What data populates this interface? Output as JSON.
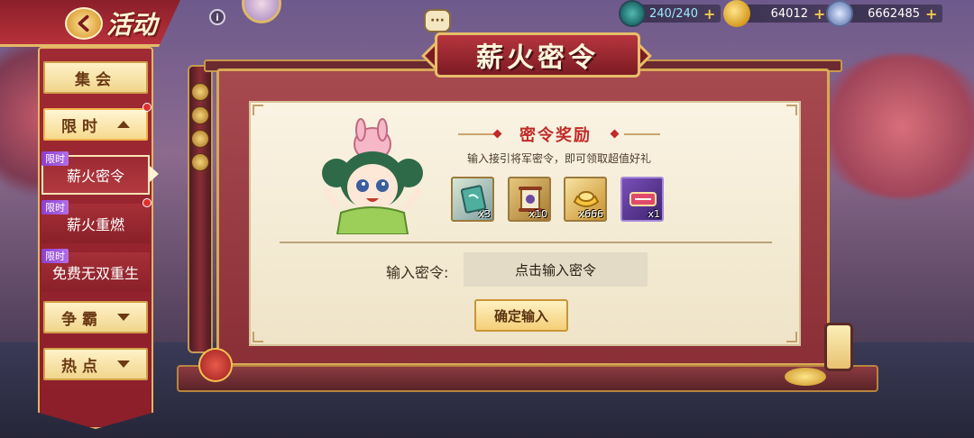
{
  "header": {
    "title": "活动",
    "info_icon_text": "i",
    "chat_icon_text": "···"
  },
  "resources": {
    "stamina": "240/240",
    "gold": "64012",
    "coin": "6662485",
    "plus": "+"
  },
  "sidebar": {
    "menu_gathering": "集会",
    "menu_limited": "限时",
    "menu_contend": "争霸",
    "menu_hot": "热点",
    "limited_tag": "限时",
    "sub_items": [
      {
        "label": "薪火密令"
      },
      {
        "label": "薪火重燃"
      },
      {
        "label": "免费无双重生"
      }
    ]
  },
  "panel": {
    "title": "薪火密令",
    "reward_title": "密令奖励",
    "reward_desc": "输入接引将军密令，即可领取超值好礼",
    "items": [
      {
        "icon": "book-icon",
        "count": "x3"
      },
      {
        "icon": "scroll-icon",
        "count": "x10"
      },
      {
        "icon": "gold-ingot-icon",
        "count": "x666"
      },
      {
        "icon": "battle-card-icon",
        "count": "x1"
      }
    ],
    "code_label": "输入密令:",
    "code_placeholder": "点击输入密令",
    "confirm_label": "确定输入"
  },
  "colors": {
    "accent_red": "#8c1f2a",
    "gold_border": "#e3b565",
    "reward_title_red": "#c02a28"
  }
}
